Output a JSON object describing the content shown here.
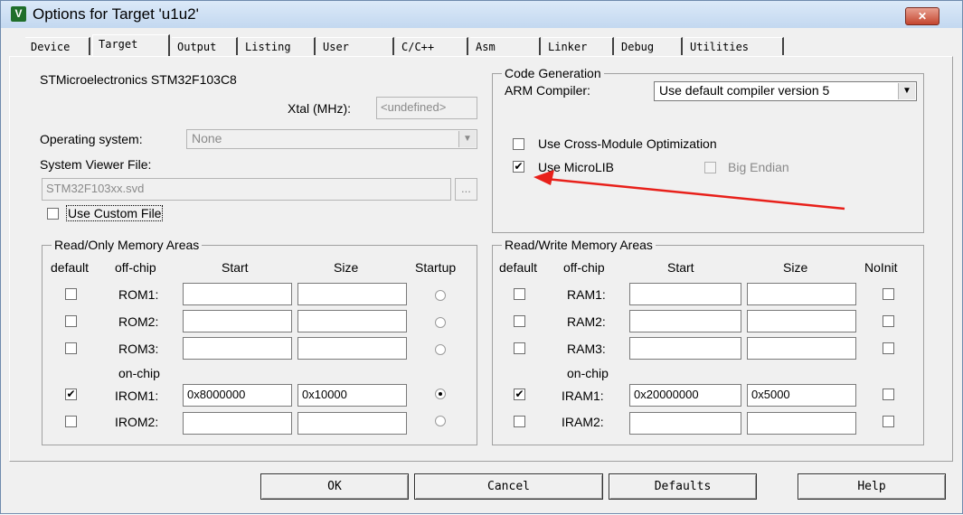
{
  "window": {
    "title": "Options for Target 'u1u2'",
    "icon_label": "V",
    "close_label": "✕"
  },
  "tabs": [
    "Device",
    "Target",
    "Output",
    "Listing",
    "User",
    "C/C++",
    "Asm",
    "Linker",
    "Debug",
    "Utilities"
  ],
  "active_tab": "Target",
  "target": {
    "device_name": "STMicroelectronics STM32F103C8",
    "xtal_label": "Xtal (MHz):",
    "xtal_value": "<undefined>",
    "os_label": "Operating system:",
    "os_value": "None",
    "svf_label": "System Viewer File:",
    "svf_value": "STM32F103xx.svd",
    "browse_label": "...",
    "use_custom_file": "Use Custom File"
  },
  "code_generation": {
    "title": "Code Generation",
    "arm_compiler_label": "ARM Compiler:",
    "arm_compiler_value": "Use default compiler version 5",
    "cross_module": {
      "label": "Use Cross-Module Optimization",
      "checked": false
    },
    "microlib": {
      "label": "Use MicroLIB",
      "checked": true
    },
    "big_endian": {
      "label": "Big Endian",
      "checked": false
    }
  },
  "rom": {
    "title": "Read/Only Memory Areas",
    "headers": {
      "default": "default",
      "offchip": "off-chip",
      "start": "Start",
      "size": "Size",
      "startup": "Startup"
    },
    "onchip_label": "on-chip",
    "rows": [
      {
        "label": "ROM1:",
        "start": "",
        "size": "",
        "default": false,
        "startup": false
      },
      {
        "label": "ROM2:",
        "start": "",
        "size": "",
        "default": false,
        "startup": false
      },
      {
        "label": "ROM3:",
        "start": "",
        "size": "",
        "default": false,
        "startup": false
      },
      {
        "label": "IROM1:",
        "start": "0x8000000",
        "size": "0x10000",
        "default": true,
        "startup": true
      },
      {
        "label": "IROM2:",
        "start": "",
        "size": "",
        "default": false,
        "startup": false
      }
    ]
  },
  "ram": {
    "title": "Read/Write Memory Areas",
    "headers": {
      "default": "default",
      "offchip": "off-chip",
      "start": "Start",
      "size": "Size",
      "noinit": "NoInit"
    },
    "onchip_label": "on-chip",
    "rows": [
      {
        "label": "RAM1:",
        "start": "",
        "size": "",
        "default": false,
        "noinit": false
      },
      {
        "label": "RAM2:",
        "start": "",
        "size": "",
        "default": false,
        "noinit": false
      },
      {
        "label": "RAM3:",
        "start": "",
        "size": "",
        "default": false,
        "noinit": false
      },
      {
        "label": "IRAM1:",
        "start": "0x20000000",
        "size": "0x5000",
        "default": true,
        "noinit": false
      },
      {
        "label": "IRAM2:",
        "start": "",
        "size": "",
        "default": false,
        "noinit": false
      }
    ]
  },
  "buttons": {
    "ok": "OK",
    "cancel": "Cancel",
    "defaults": "Defaults",
    "help": "Help"
  },
  "annotation": {
    "arrow_color": "#e8201a"
  },
  "check_mark": "✔"
}
